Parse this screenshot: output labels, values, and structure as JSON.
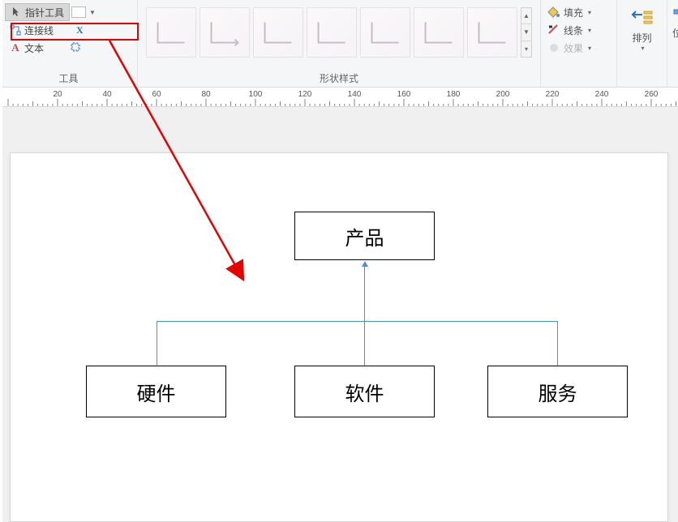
{
  "ribbon": {
    "tools": {
      "pointer_label": "指针工具",
      "connector_label": "连接线",
      "connector_close": "X",
      "text_label": "文本",
      "group_title": "工具"
    },
    "shapes": {
      "group_title": "形状样式"
    },
    "format": {
      "fill_label": "填充",
      "line_label": "线条",
      "effect_label": "效果"
    },
    "arrange": {
      "label": "排列"
    },
    "position": {
      "label": "位"
    }
  },
  "ruler": {
    "ticks": [
      20,
      40,
      60,
      80,
      100,
      120,
      140,
      160,
      180,
      200,
      220,
      240,
      260
    ]
  },
  "diagram": {
    "root": "产品",
    "children": [
      "硬件",
      "软件",
      "服务"
    ]
  }
}
